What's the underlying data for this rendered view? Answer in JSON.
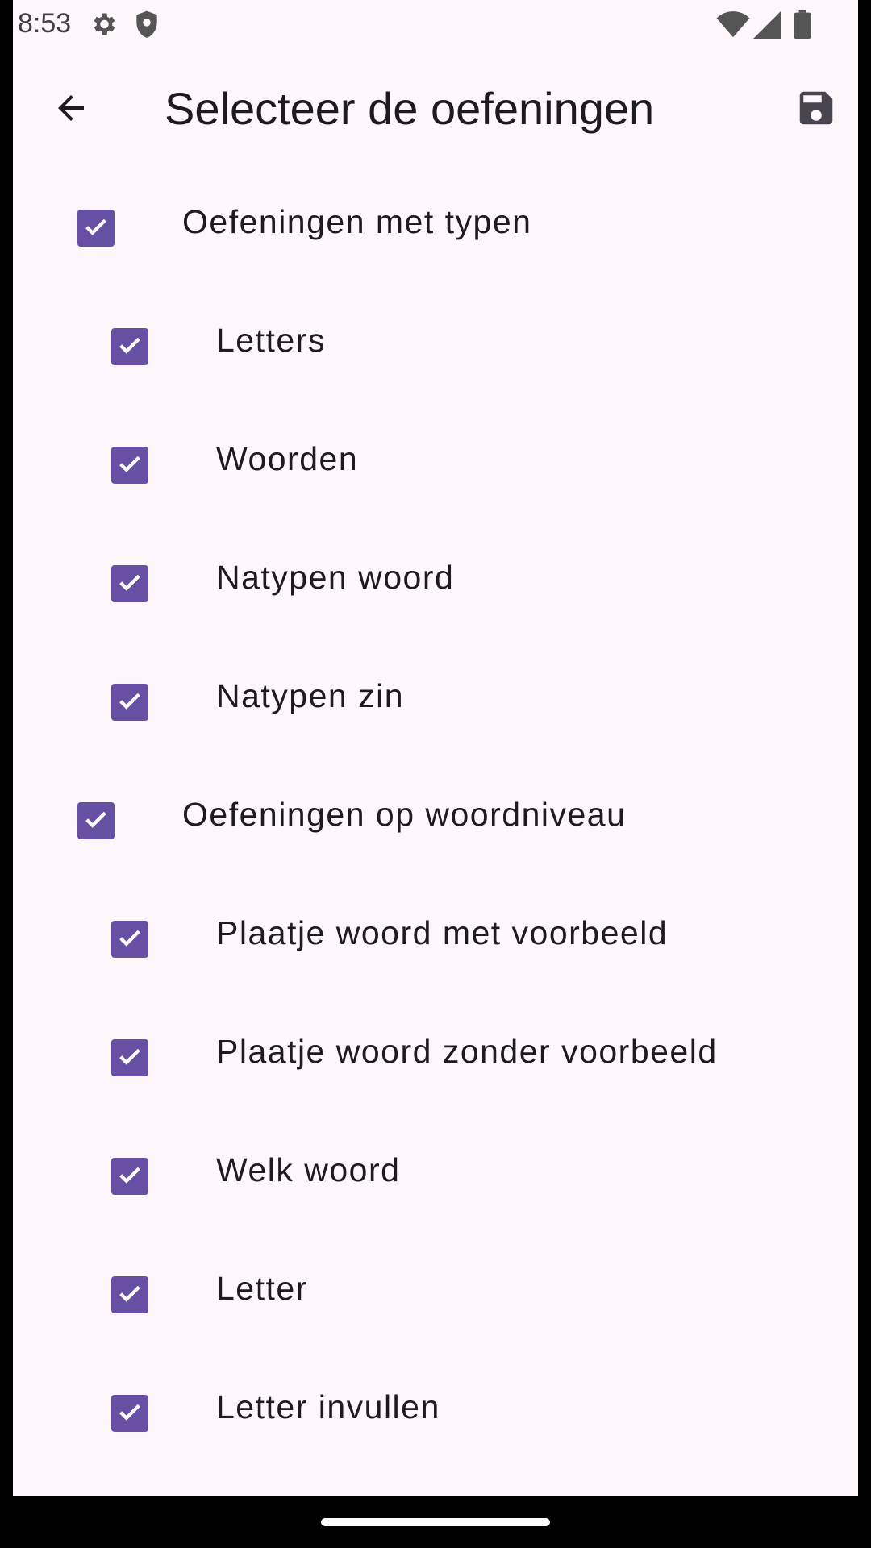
{
  "status_bar": {
    "time": "8:53",
    "icons": [
      "gear-icon",
      "shield-icon",
      "wifi-icon",
      "signal-icon",
      "battery-icon"
    ]
  },
  "app_bar": {
    "title": "Selecteer de oefeningen",
    "back_icon": "arrow-back-icon",
    "save_icon": "save-icon"
  },
  "colors": {
    "accent": "#6750a4",
    "background": "#fdf7fc",
    "text": "#1d1b20"
  },
  "items": [
    {
      "label": "Oefeningen met typen",
      "level": 0,
      "checked": true
    },
    {
      "label": "Letters",
      "level": 1,
      "checked": true
    },
    {
      "label": "Woorden",
      "level": 1,
      "checked": true
    },
    {
      "label": "Natypen woord",
      "level": 1,
      "checked": true
    },
    {
      "label": "Natypen zin",
      "level": 1,
      "checked": true
    },
    {
      "label": "Oefeningen op woordniveau",
      "level": 0,
      "checked": true
    },
    {
      "label": "Plaatje woord met voorbeeld",
      "level": 1,
      "checked": true
    },
    {
      "label": "Plaatje woord zonder voorbeeld",
      "level": 1,
      "checked": true
    },
    {
      "label": "Welk woord",
      "level": 1,
      "checked": true
    },
    {
      "label": "Letter",
      "level": 1,
      "checked": true
    },
    {
      "label": "Letter invullen",
      "level": 1,
      "checked": true
    }
  ]
}
